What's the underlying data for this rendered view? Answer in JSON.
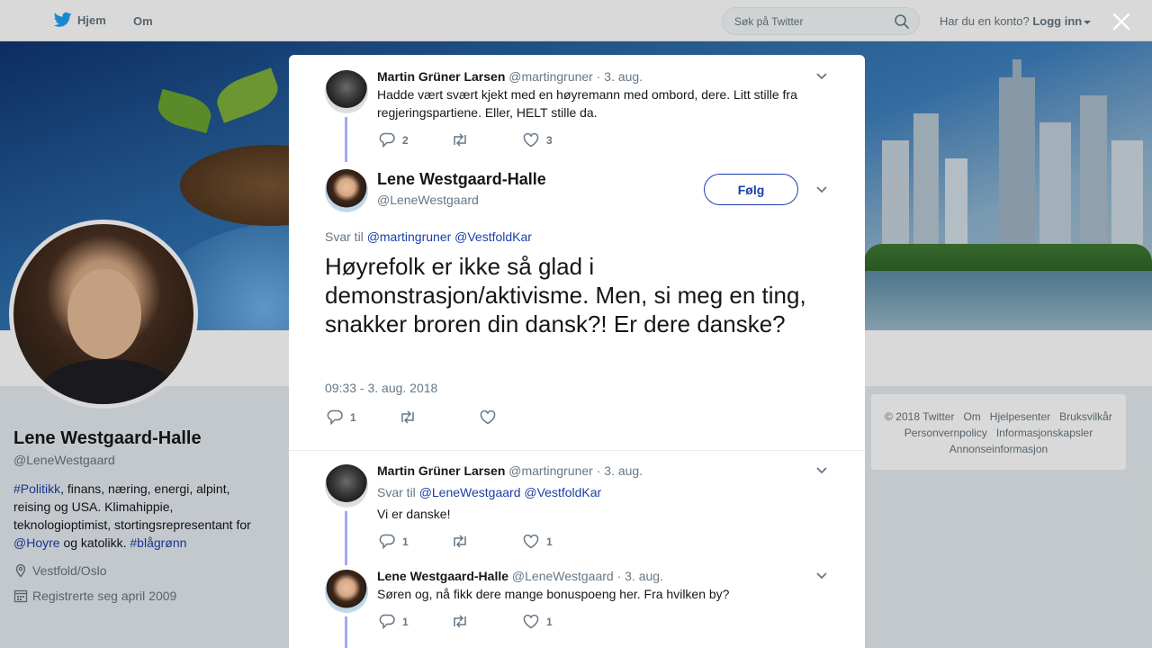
{
  "nav": {
    "home_label": "Hjem",
    "about_label": "Om",
    "search_placeholder": "Søk på Twitter",
    "account_prompt": "Har du en konto?",
    "login_label": "Logg inn"
  },
  "profile": {
    "name": "Lene Westgaard-Halle",
    "handle": "@LeneWestgaard",
    "bio_parts": [
      "#Politikk",
      ", finans, næring, energi, alpint, reising og USA. Klimahippie, teknologioptimist, stortingsrepresentant for ",
      "@Hoyre",
      " og katolikk. ",
      "#blågrønn"
    ],
    "location": "Vestfold/Oslo",
    "joined": "Registrerte seg april 2009"
  },
  "footer": {
    "links": [
      "© 2018 Twitter",
      "Om",
      "Hjelpesenter",
      "Bruksvilkår",
      "Personvernpolicy",
      "Informasjonskapsler",
      "Annonseinformasjon"
    ]
  },
  "modal": {
    "parent_tweet": {
      "name": "Martin Grüner Larsen",
      "handle": "@martingruner",
      "date": "· 3. aug.",
      "text": "Hadde vært svært kjekt med en høyremann med ombord, dere. Litt stille fra regjeringspartiene. Eller, HELT stille da.",
      "replies": "2",
      "likes": "3"
    },
    "main_tweet": {
      "name": "Lene Westgaard-Halle",
      "handle": "@LeneWestgaard",
      "follow_label": "Følg",
      "reply_prefix": "Svar til",
      "reply_mentions": "@martingruner @VestfoldKar",
      "text": "Høyrefolk er ikke så glad i demonstrasjon/aktivisme. Men, si meg en ting, snakker broren din dansk?! Er dere danske?",
      "timestamp": "09:33 - 3. aug. 2018",
      "replies": "1"
    },
    "reply_1": {
      "name": "Martin Grüner Larsen",
      "handle": "@martingruner",
      "date": "· 3. aug.",
      "reply_prefix": "Svar til",
      "reply_mentions": "@LeneWestgaard @VestfoldKar",
      "text": "Vi er danske!",
      "replies": "1",
      "likes": "1"
    },
    "reply_2": {
      "name": "Lene Westgaard-Halle",
      "handle": "@LeneWestgaard",
      "date": "· 3. aug.",
      "text": "Søren og, nå fikk dere mange bonuspoeng her. Fra hvilken by?",
      "replies": "1",
      "likes": "1"
    }
  },
  "colors": {
    "link": "#1b3fa8",
    "thread_line": "#a2a8f0",
    "muted": "#657786"
  }
}
